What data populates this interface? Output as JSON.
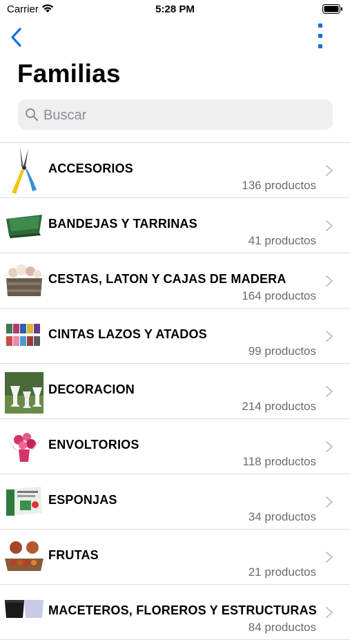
{
  "status_bar": {
    "carrier": "Carrier",
    "time": "5:28 PM"
  },
  "nav": {
    "back_icon": "chevron-left-icon",
    "more_icon": "more-vertical-icon",
    "accent_color": "#1a6fe0"
  },
  "title": "Familias",
  "search": {
    "placeholder": "Buscar",
    "value": ""
  },
  "families": [
    {
      "name": "ACCESORIOS",
      "count": "136 productos"
    },
    {
      "name": "BANDEJAS Y TARRINAS",
      "count": "41 productos"
    },
    {
      "name": "CESTAS, LATON Y CAJAS DE MADERA",
      "count": "164 productos"
    },
    {
      "name": "CINTAS LAZOS Y ATADOS",
      "count": "99 productos"
    },
    {
      "name": "DECORACION",
      "count": "214 productos"
    },
    {
      "name": "ENVOLTORIOS",
      "count": "118 productos"
    },
    {
      "name": "ESPONJAS",
      "count": "34 productos"
    },
    {
      "name": "FRUTAS",
      "count": "21 productos"
    },
    {
      "name": "MACETEROS, FLOREROS Y ESTRUCTURAS",
      "count": "84 productos"
    }
  ]
}
